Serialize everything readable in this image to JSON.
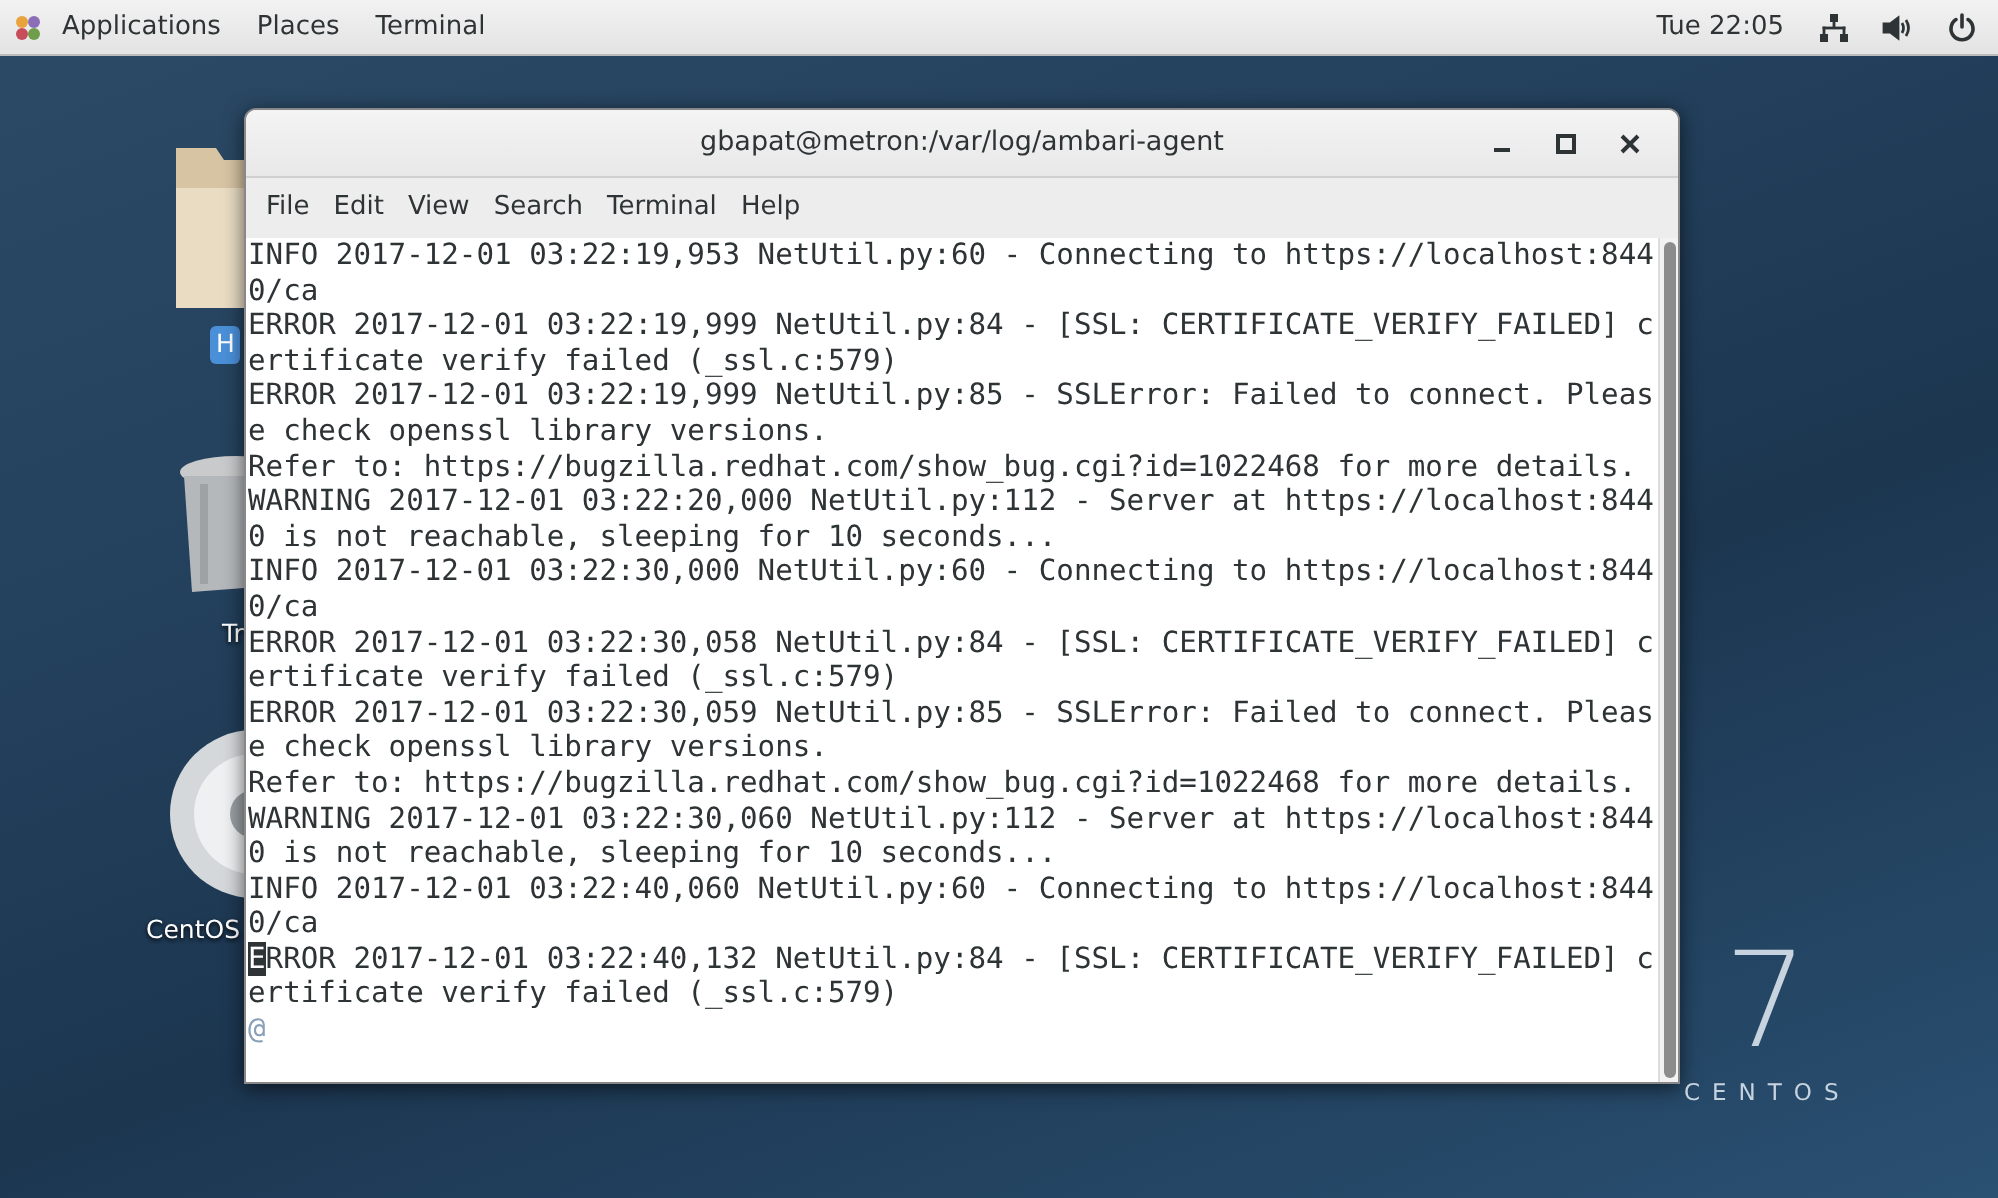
{
  "top_bar": {
    "menus": [
      "Applications",
      "Places",
      "Terminal"
    ],
    "clock": "Tue 22:05"
  },
  "desktop": {
    "icons": [
      {
        "kind": "folder",
        "label": "H"
      },
      {
        "kind": "trash",
        "label": "Tr"
      },
      {
        "kind": "disc",
        "label": "CentOS"
      }
    ],
    "logo": {
      "numeral": "7",
      "wordmark": "CENTOS"
    }
  },
  "window": {
    "title": "gbapat@metron:/var/log/ambari-agent",
    "menu": [
      "File",
      "Edit",
      "View",
      "Search",
      "Terminal",
      "Help"
    ],
    "lines": [
      {
        "kind": "text",
        "text": "INFO 2017-12-01 03:22:19,953 NetUtil.py:60 - Connecting to https://localhost:844"
      },
      {
        "kind": "text",
        "text": "0/ca"
      },
      {
        "kind": "text",
        "text": "ERROR 2017-12-01 03:22:19,999 NetUtil.py:84 - [SSL: CERTIFICATE_VERIFY_FAILED] c"
      },
      {
        "kind": "text",
        "text": "ertificate verify failed (_ssl.c:579)"
      },
      {
        "kind": "text",
        "text": "ERROR 2017-12-01 03:22:19,999 NetUtil.py:85 - SSLError: Failed to connect. Pleas"
      },
      {
        "kind": "text",
        "text": "e check openssl library versions."
      },
      {
        "kind": "text",
        "text": "Refer to: https://bugzilla.redhat.com/show_bug.cgi?id=1022468 for more details."
      },
      {
        "kind": "text",
        "text": "WARNING 2017-12-01 03:22:20,000 NetUtil.py:112 - Server at https://localhost:844"
      },
      {
        "kind": "text",
        "text": "0 is not reachable, sleeping for 10 seconds..."
      },
      {
        "kind": "text",
        "text": "INFO 2017-12-01 03:22:30,000 NetUtil.py:60 - Connecting to https://localhost:844"
      },
      {
        "kind": "text",
        "text": "0/ca"
      },
      {
        "kind": "text",
        "text": "ERROR 2017-12-01 03:22:30,058 NetUtil.py:84 - [SSL: CERTIFICATE_VERIFY_FAILED] c"
      },
      {
        "kind": "text",
        "text": "ertificate verify failed (_ssl.c:579)"
      },
      {
        "kind": "text",
        "text": "ERROR 2017-12-01 03:22:30,059 NetUtil.py:85 - SSLError: Failed to connect. Pleas"
      },
      {
        "kind": "text",
        "text": "e check openssl library versions."
      },
      {
        "kind": "text",
        "text": "Refer to: https://bugzilla.redhat.com/show_bug.cgi?id=1022468 for more details."
      },
      {
        "kind": "text",
        "text": "WARNING 2017-12-01 03:22:30,060 NetUtil.py:112 - Server at https://localhost:844"
      },
      {
        "kind": "text",
        "text": "0 is not reachable, sleeping for 10 seconds..."
      },
      {
        "kind": "text",
        "text": "INFO 2017-12-01 03:22:40,060 NetUtil.py:60 - Connecting to https://localhost:844"
      },
      {
        "kind": "text",
        "text": "0/ca"
      },
      {
        "kind": "cursor",
        "cursor_char": "E",
        "text": "RROR 2017-12-01 03:22:40,132 NetUtil.py:84 - [SSL: CERTIFICATE_VERIFY_FAILED] c"
      },
      {
        "kind": "text",
        "text": "ertificate verify failed (_ssl.c:579)"
      },
      {
        "kind": "prompt",
        "text": "@"
      }
    ]
  }
}
